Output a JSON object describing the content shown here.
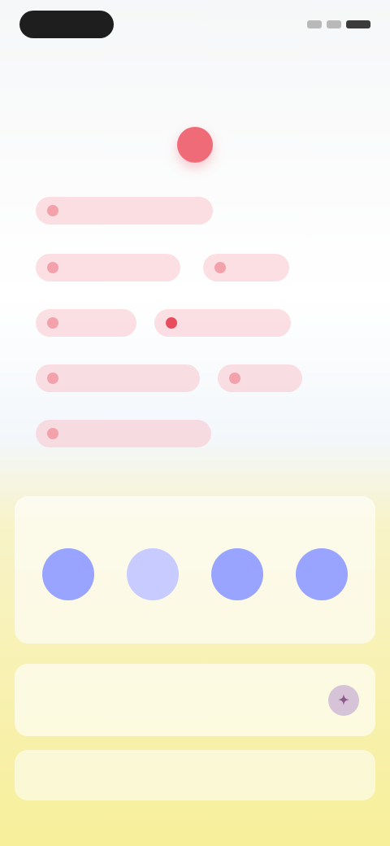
{
  "statusbar": {
    "left_label": "",
    "right_icons": [
      "signal-icon",
      "wifi-icon",
      "battery-icon"
    ]
  },
  "calendar": {
    "month": "",
    "days": [
      {
        "name": "",
        "num": "",
        "today": false
      },
      {
        "name": "",
        "num": "",
        "today": false
      },
      {
        "name": "",
        "num": "",
        "today": false
      },
      {
        "name": "",
        "num": "",
        "today": true
      },
      {
        "name": "",
        "num": "",
        "today": false
      },
      {
        "name": "",
        "num": "",
        "today": false
      },
      {
        "name": "",
        "num": "",
        "today": false
      }
    ]
  },
  "tags": [
    {
      "label": "",
      "emphasis": "normal"
    },
    {
      "label": "",
      "emphasis": "normal"
    },
    {
      "label": "",
      "emphasis": "normal"
    },
    {
      "label": "",
      "emphasis": "normal"
    },
    {
      "label": "",
      "emphasis": "red"
    },
    {
      "label": "",
      "emphasis": "normal"
    },
    {
      "label": "",
      "emphasis": "normal"
    },
    {
      "label": "",
      "emphasis": "normal"
    }
  ],
  "friends": {
    "title": "",
    "items": [
      {
        "name": "",
        "avatar_style": "strong"
      },
      {
        "name": "",
        "avatar_style": "light"
      },
      {
        "name": "",
        "avatar_style": "strong"
      },
      {
        "name": "",
        "avatar_style": "strong"
      }
    ]
  },
  "promo": {
    "title": "",
    "subtitle": "",
    "icon": "gift-icon"
  },
  "bottom_button": {
    "label": ""
  }
}
